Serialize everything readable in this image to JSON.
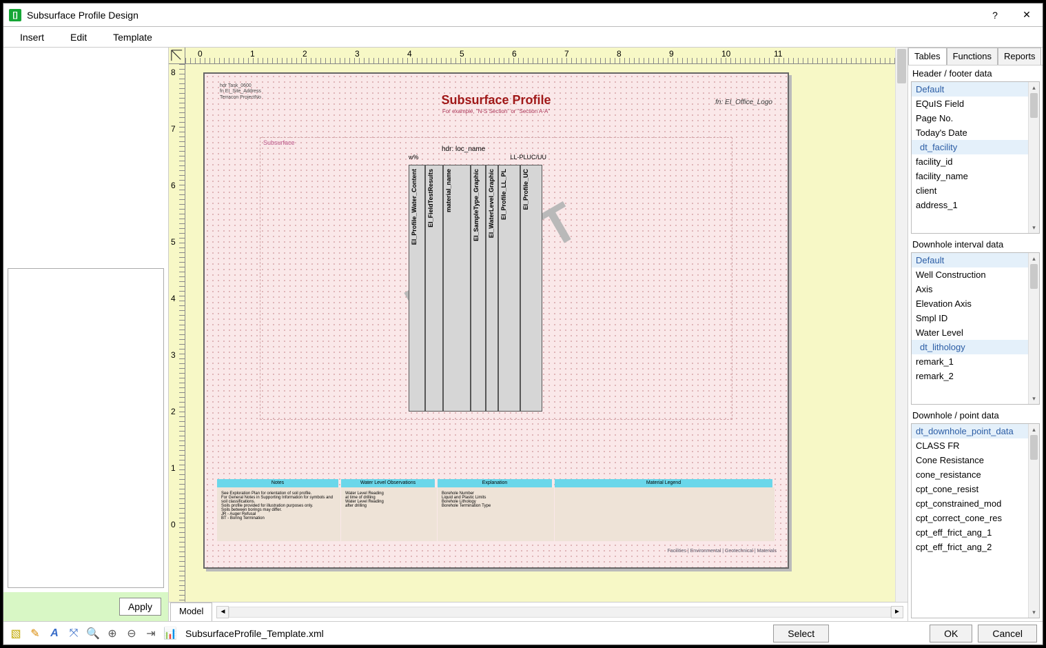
{
  "window": {
    "title": "Subsurface Profile Design"
  },
  "menu": {
    "insert": "Insert",
    "edit": "Edit",
    "template": "Template"
  },
  "left": {
    "apply": "Apply"
  },
  "canvas": {
    "rulerH": [
      "0",
      "1",
      "2",
      "3",
      "4",
      "5",
      "6",
      "7",
      "8",
      "9",
      "10",
      "11"
    ],
    "rulerV": [
      "8",
      "7",
      "6",
      "5",
      "4",
      "3",
      "2",
      "1",
      "0"
    ],
    "page": {
      "title": "Subsurface Profile",
      "subtitle": "For example, \"N-S Section\" or \"Section A-A\"",
      "logo": "fn: EI_Office_Logo",
      "hdrLines": [
        "hdr Task_0600",
        "fn EI_Site_Address",
        "Terracon ProjectNo"
      ],
      "subsurf": "Subsurface",
      "draft": "DRAFT",
      "colhdr1": "hdr: loc_name",
      "colhdr2": "w%",
      "colhdr3": "LL-PLUC/UU",
      "colLabels": [
        "EI_Profile_Water_Content",
        "EI_FieldTestResults",
        "material_name",
        "EI_SampleType_Graphic",
        "EI_WaterLevel_Graphic",
        "EI_Profile_LL_PL",
        "EI_Profile_UC"
      ],
      "footerHdrs": [
        "Notes",
        "Water Level Observations",
        "Explanation",
        "Material Legend"
      ],
      "notes": [
        "See Exploration Plan for orientation of soil profile.",
        "For General Notes in Supporting Information for symbols and",
        "soil classifications.",
        "Soils profile provided for illustration purposes only.",
        "Soils between borings may differ.",
        "JR - Auger Refusal",
        "BT - Boring Termination"
      ],
      "waterObs": [
        "Water Level Reading",
        "at time of drilling",
        "",
        "Water Level Reading",
        "after drilling"
      ],
      "explan": [
        "Borehole Number",
        "Liquid and Plastic Limits",
        "Borehole Lithology",
        "Borehole Termination Type"
      ],
      "breadcrumb": "Facilities  |  Environmental  |  Geotechnical  |  Materials"
    },
    "modelTab": "Model"
  },
  "right": {
    "tabs": {
      "tables": "Tables",
      "functions": "Functions",
      "reports": "Reports"
    },
    "sec1": {
      "title": "Header / footer data",
      "items": [
        "Default",
        "EQuIS Field",
        "Page No.",
        "Today's Date",
        "dt_facility",
        "facility_id",
        "facility_name",
        "client",
        "address_1"
      ],
      "hdrIdx": 0,
      "selIdx": 4
    },
    "sec2": {
      "title": "Downhole interval data",
      "items": [
        "Default",
        "Well Construction",
        "Axis",
        "Elevation Axis",
        "Smpl ID",
        "Water Level",
        "dt_lithology",
        "remark_1",
        "remark_2"
      ],
      "hdrIdx": 0,
      "selIdx": 6
    },
    "sec3": {
      "title": "Downhole / point data",
      "items": [
        "dt_downhole_point_data",
        "CLASS FR",
        "Cone Resistance",
        "cone_resistance",
        "cpt_cone_resist",
        "cpt_constrained_mod",
        "cpt_correct_cone_res",
        "cpt_eff_frict_ang_1",
        "cpt_eff_frict_ang_2"
      ],
      "hdrIdx": 0,
      "selIdx": -1
    }
  },
  "toolbar": {
    "filename": "SubsurfaceProfile_Template.xml",
    "select": "Select",
    "ok": "OK",
    "cancel": "Cancel"
  }
}
